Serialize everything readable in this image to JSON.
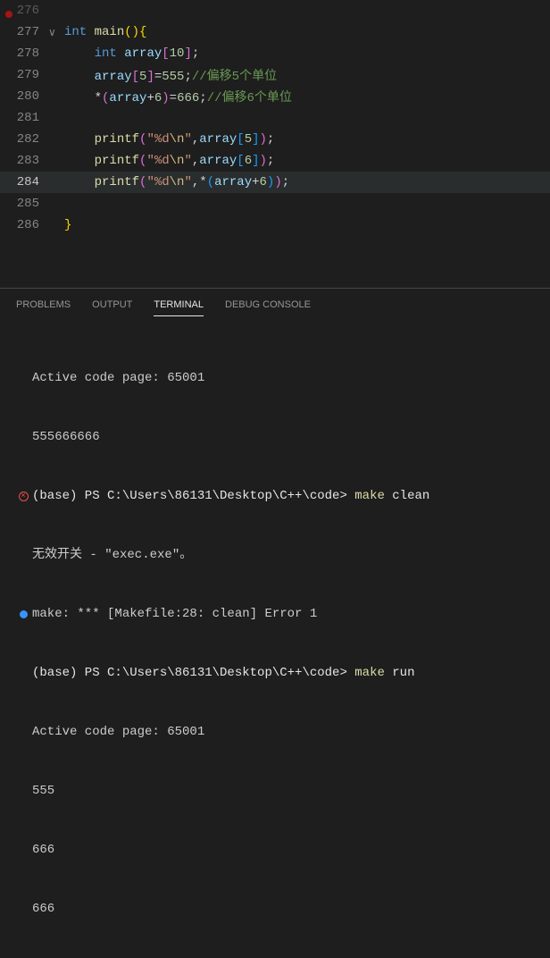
{
  "editor": {
    "lines": {
      "l276": "276",
      "l277": "277",
      "l278": "278",
      "l279": "279",
      "l280": "280",
      "l281": "281",
      "l282": "282",
      "l283": "283",
      "l284": "284",
      "l285": "285",
      "l286": "286"
    },
    "tokens": {
      "kw_int": "int",
      "fn_main": "main",
      "id_array": "array",
      "n10": "10",
      "n5": "5",
      "n555": "555",
      "n6": "6",
      "n666": "666",
      "fn_printf": "printf",
      "str_fmt_open": "\"%d",
      "esc_n": "\\n",
      "str_close": "\"",
      "star": "*",
      "plus": "+",
      "eq": "=",
      "semi": ";",
      "comma": ",",
      "lparen": "(",
      "rparen": ")",
      "lbrace": "{",
      "rbrace": "}",
      "lbrack": "[",
      "rbrack": "]",
      "cmt5": "//偏移5个单位",
      "cmt6": "//偏移6个单位"
    }
  },
  "panel": {
    "tabs": {
      "problems": "PROBLEMS",
      "output": "OUTPUT",
      "terminal": "TERMINAL",
      "debug": "DEBUG CONSOLE"
    }
  },
  "terminal": {
    "l1": "Active code page: 65001",
    "l2": "555666666",
    "l3_prompt": "(base) PS C:\\Users\\86131\\Desktop\\C++\\code> ",
    "l3_cmd": "make",
    "l3_arg": " clean",
    "l4": "无效开关 - \"exec.exe\"。",
    "l5": "make: *** [Makefile:28: clean] Error 1",
    "l6_prompt": "(base) PS C:\\Users\\86131\\Desktop\\C++\\code> ",
    "l6_cmd": "make",
    "l6_arg": " run",
    "l7": "Active code page: 65001",
    "l8": "555",
    "l9": "666",
    "l10": "666"
  }
}
